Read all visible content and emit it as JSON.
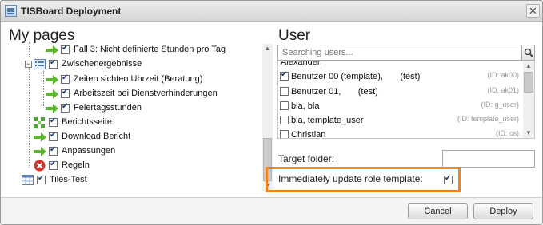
{
  "dialog": {
    "title": "TISBoard Deployment",
    "close_glyph": "✕"
  },
  "left": {
    "heading": "My pages",
    "tree": [
      {
        "label": "Fall 3: Nicht definierte Stunden pro Tag",
        "icon": "green-arrow-icon",
        "checked": true
      },
      {
        "label": "Zwischenergebnisse",
        "icon": "list-page-icon",
        "checked": true
      },
      {
        "label": "Zeiten sichten Uhrzeit (Beratung)",
        "icon": "green-arrow-icon",
        "checked": true
      },
      {
        "label": "Arbeitszeit bei Dienstverhinderungen",
        "icon": "green-arrow-icon",
        "checked": true
      },
      {
        "label": "Feiertagsstunden",
        "icon": "green-arrow-icon",
        "checked": true
      },
      {
        "label": "Berichtsseite",
        "icon": "green-grid-icon",
        "checked": true
      },
      {
        "label": "Download Bericht",
        "icon": "green-arrow-icon",
        "checked": true
      },
      {
        "label": "Anpassungen",
        "icon": "green-arrow-icon",
        "checked": true
      },
      {
        "label": "Regeln",
        "icon": "red-x-icon",
        "checked": true
      },
      {
        "label": "Tiles-Test",
        "icon": "calendar-grid-icon",
        "checked": true
      }
    ]
  },
  "right": {
    "heading": "User",
    "search_placeholder": "Searching users...",
    "users": [
      {
        "name": "Alexander,",
        "id": "",
        "checked": false
      },
      {
        "name": "Benutzer 00 (template),       (test)",
        "id": "(ID: ak00)",
        "checked": true
      },
      {
        "name": "Benutzer 01,       (test)",
        "id": "(ID: ak01)",
        "checked": false
      },
      {
        "name": "bla, bla",
        "id": "(ID: g_user)",
        "checked": false
      },
      {
        "name": "bla, template_user",
        "id": "(ID: template_user)",
        "checked": false
      },
      {
        "name": "Christian",
        "id": "(ID: cs)",
        "checked": false
      }
    ],
    "target_folder_label": "Target folder:",
    "target_folder_value": "",
    "immediate_label": "Immediately update role template:",
    "immediate_checked": true,
    "highlight_color": "#f0831f"
  },
  "footer": {
    "cancel_label": "Cancel",
    "deploy_label": "Deploy"
  }
}
